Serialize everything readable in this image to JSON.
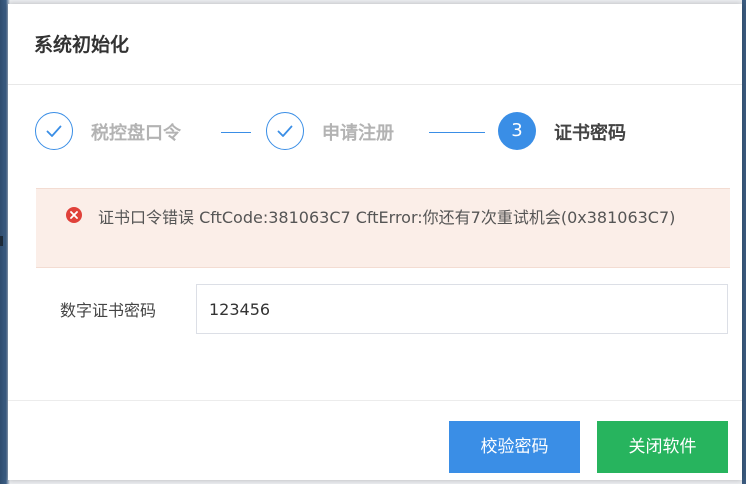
{
  "dialog": {
    "title": "系统初始化"
  },
  "steps": [
    {
      "label": "税控盘口令",
      "state": "done",
      "icon": "check-icon"
    },
    {
      "label": "申请注册",
      "state": "done",
      "icon": "check-icon"
    },
    {
      "label": "证书密码",
      "state": "active",
      "number": "3"
    }
  ],
  "alert": {
    "icon": "error-icon",
    "message": "证书口令错误 CftCode:381063C7 CftError:你还有7次重试机会(0x381063C7)"
  },
  "form": {
    "cert_password_label": "数字证书密码",
    "cert_password_value": "123456"
  },
  "buttons": {
    "verify_label": "校验密码",
    "close_label": "关闭软件"
  },
  "colors": {
    "primary": "#3a8ee6",
    "success": "#27b45e",
    "error": "#e0413a",
    "alert_bg": "#fbeee8"
  }
}
